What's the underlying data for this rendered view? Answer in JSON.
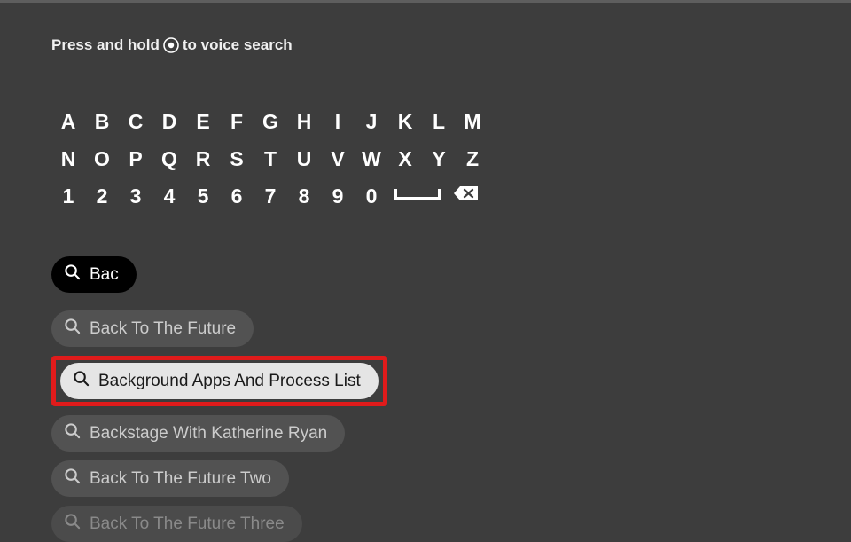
{
  "hint": {
    "prefix": "Press and hold",
    "suffix": "to voice search"
  },
  "keyboard": {
    "row1": [
      "A",
      "B",
      "C",
      "D",
      "E",
      "F",
      "G",
      "H",
      "I",
      "J",
      "K",
      "L",
      "M"
    ],
    "row2": [
      "N",
      "O",
      "P",
      "Q",
      "R",
      "S",
      "T",
      "U",
      "V",
      "W",
      "X",
      "Y",
      "Z"
    ],
    "row3": [
      "1",
      "2",
      "3",
      "4",
      "5",
      "6",
      "7",
      "8",
      "9",
      "0"
    ]
  },
  "query": "Bac",
  "suggestions": [
    {
      "label": "Back To The Future",
      "style": "default"
    },
    {
      "label": "Background Apps And Process List",
      "style": "highlighted"
    },
    {
      "label": "Backstage With Katherine Ryan",
      "style": "default"
    },
    {
      "label": "Back To The Future Two",
      "style": "default"
    },
    {
      "label": "Back To The Future Three",
      "style": "faded"
    }
  ]
}
